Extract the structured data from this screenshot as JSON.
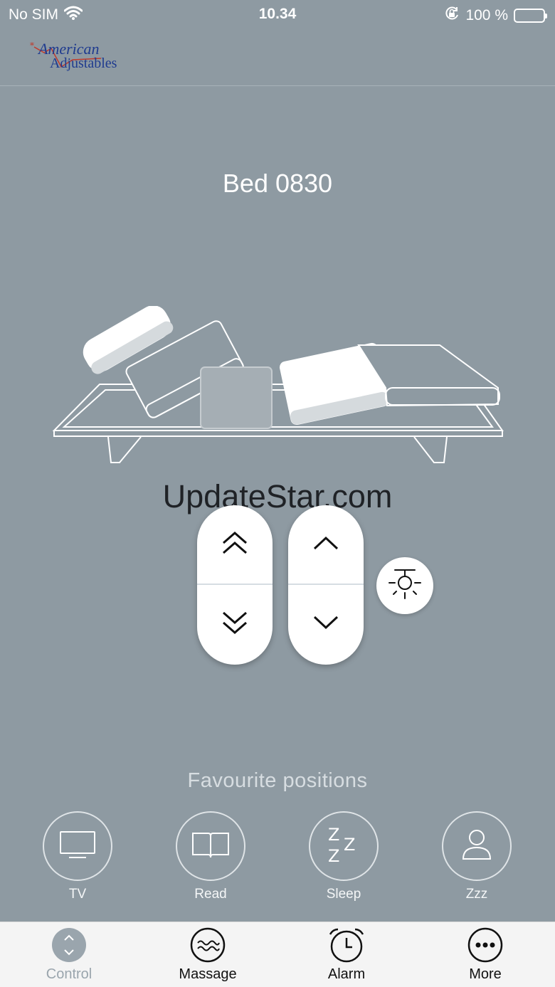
{
  "status_bar": {
    "carrier": "No SIM",
    "time": "10.34",
    "battery_text": "100 %"
  },
  "header": {
    "logo_line1": "American",
    "logo_line2": "Adjustables"
  },
  "bed": {
    "name": "Bed 0830"
  },
  "watermark": "UpdateStar.com",
  "controls": {
    "head_up_icon": "double-chevron-up-icon",
    "head_down_icon": "double-chevron-down-icon",
    "foot_up_icon": "chevron-up-icon",
    "foot_down_icon": "chevron-down-icon",
    "light_icon": "light-icon"
  },
  "favourites": {
    "title": "Favourite positions",
    "items": [
      {
        "label": "TV",
        "icon": "tv-icon"
      },
      {
        "label": "Read",
        "icon": "book-icon"
      },
      {
        "label": "Sleep",
        "icon": "sleep-icon"
      },
      {
        "label": "Zzz",
        "icon": "user-icon"
      }
    ]
  },
  "tabs": [
    {
      "label": "Control",
      "icon": "control-icon",
      "active": true
    },
    {
      "label": "Massage",
      "icon": "massage-icon",
      "active": false
    },
    {
      "label": "Alarm",
      "icon": "alarm-icon",
      "active": false
    },
    {
      "label": "More",
      "icon": "more-icon",
      "active": false
    }
  ],
  "colors": {
    "background": "#8e9aa2",
    "tab_bar": "#f4f4f4",
    "active_tab": "#9aa5ad",
    "logo_blue": "#1f3b8f",
    "logo_red": "#c0392b"
  }
}
